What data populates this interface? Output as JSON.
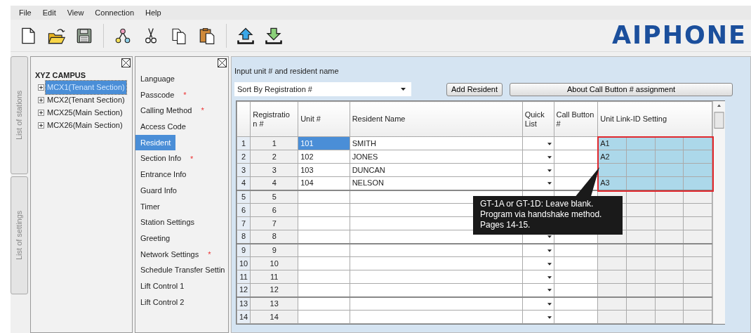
{
  "menu": [
    "File",
    "Edit",
    "View",
    "Connection",
    "Help"
  ],
  "logo": "AIPHONE",
  "side_tabs": [
    {
      "label": "List of stations",
      "selected": false
    },
    {
      "label": "List of settings",
      "selected": false
    }
  ],
  "stations": {
    "root": "XYZ CAMPUS",
    "children": [
      {
        "label": "MCX1(Tenant Section)",
        "selected": true
      },
      {
        "label": "MCX2(Tenant Section)",
        "selected": false
      },
      {
        "label": "MCX25(Main Section)",
        "selected": false
      },
      {
        "label": "MCX26(Main Section)",
        "selected": false
      }
    ]
  },
  "settings": [
    {
      "label": "Language",
      "required": false,
      "selected": false
    },
    {
      "label": "Passcode",
      "required": true,
      "selected": false
    },
    {
      "label": "Calling Method",
      "required": true,
      "selected": false
    },
    {
      "label": "Access Code",
      "required": false,
      "selected": false
    },
    {
      "label": "Resident",
      "required": false,
      "selected": true
    },
    {
      "label": "Section Info",
      "required": true,
      "selected": false
    },
    {
      "label": "Entrance Info",
      "required": false,
      "selected": false
    },
    {
      "label": "Guard Info",
      "required": false,
      "selected": false
    },
    {
      "label": "Timer",
      "required": false,
      "selected": false
    },
    {
      "label": "Station Settings",
      "required": false,
      "selected": false
    },
    {
      "label": "Greeting",
      "required": false,
      "selected": false
    },
    {
      "label": "Network Settings",
      "required": true,
      "selected": false
    },
    {
      "label": "Schedule Transfer Settin",
      "required": false,
      "selected": false
    },
    {
      "label": "Lift Control 1",
      "required": false,
      "selected": false
    },
    {
      "label": "Lift Control 2",
      "required": false,
      "selected": false
    }
  ],
  "required_mark": "*",
  "main": {
    "instruction": "Input unit # and resident name",
    "sort": "Sort By Registration #",
    "add_button": "Add Resident",
    "about_button": "About Call Button # assignment"
  },
  "table": {
    "columns": [
      "Registratio n #",
      "Unit #",
      "Resident Name",
      "Quick List",
      "Call Button #",
      "Unit Link-ID Setting"
    ],
    "rows": [
      {
        "number": "1",
        "registration": "1",
        "unit": "101",
        "name": "SMITH",
        "link_id": "A1",
        "unit_selected": true,
        "link_highlighted": true
      },
      {
        "number": "2",
        "registration": "2",
        "unit": "102",
        "name": "JONES",
        "link_id": "A2",
        "unit_selected": false,
        "link_highlighted": true
      },
      {
        "number": "3",
        "registration": "3",
        "unit": "103",
        "name": "DUNCAN",
        "unit_selected": false,
        "link_highlighted": true
      },
      {
        "number": "4",
        "registration": "4",
        "unit": "104",
        "name": "NELSON",
        "link_id": "A3",
        "unit_selected": false,
        "link_highlighted": true
      },
      {
        "number": "5",
        "registration": "5",
        "unit_selected": false,
        "link_highlighted": false
      },
      {
        "number": "6",
        "registration": "6",
        "unit_selected": false,
        "link_highlighted": false
      },
      {
        "number": "7",
        "registration": "7",
        "unit_selected": false,
        "link_highlighted": false
      },
      {
        "number": "8",
        "registration": "8",
        "unit_selected": false,
        "link_highlighted": false
      },
      {
        "number": "9",
        "registration": "9",
        "unit_selected": false,
        "link_highlighted": false
      },
      {
        "number": "10",
        "registration": "10",
        "unit_selected": false,
        "link_highlighted": false
      },
      {
        "number": "11",
        "registration": "11",
        "unit_selected": false,
        "link_highlighted": false
      },
      {
        "number": "12",
        "registration": "12",
        "unit_selected": false,
        "link_highlighted": false
      },
      {
        "number": "13",
        "registration": "13",
        "unit_selected": false,
        "link_highlighted": false
      },
      {
        "number": "14",
        "registration": "14",
        "unit_selected": false,
        "link_highlighted": false
      }
    ]
  },
  "callout": "GT-1A or GT-1D: Leave blank. Program via handshake method. Pages 14-15."
}
